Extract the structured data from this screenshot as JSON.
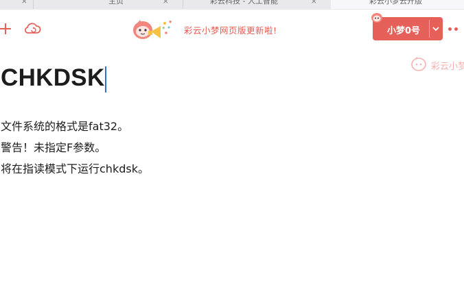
{
  "tabs": [
    {
      "label": "主页",
      "close": "×"
    },
    {
      "label": "彩云科技 - 人工智能",
      "close": "×"
    },
    {
      "label": "彩云小梦云开版",
      "close": "×"
    }
  ],
  "toolbar": {
    "new_icon": "plus-icon",
    "cloud_icon": "cloud-sync-icon",
    "promo_text": "彩云小梦网页版更新啦!"
  },
  "account": {
    "name": "小梦0号",
    "chevron": "chevron-down-icon",
    "more": "more-icon"
  },
  "watermark": {
    "text": "彩云小梦"
  },
  "document": {
    "title": "CHKDSK",
    "lines": [
      "文件系统的格式是fat32。",
      "警告！未指定F参数。",
      "将在指读模式下运行chkdsk。"
    ]
  },
  "colors": {
    "accent": "#e6605a",
    "caret": "#2b6fd6",
    "watermark": "#f3b3af"
  }
}
